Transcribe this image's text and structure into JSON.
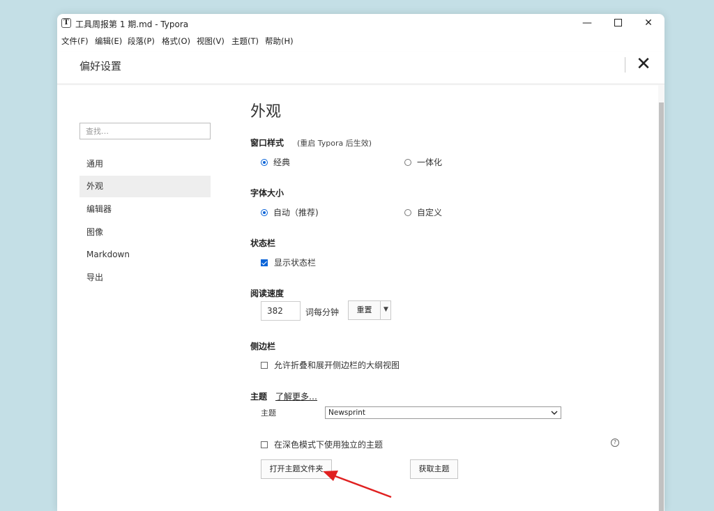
{
  "window": {
    "app_icon": "T",
    "title": "工具周报第 1 期.md - Typora",
    "controls": {
      "minimize": "—",
      "close": "✕"
    }
  },
  "menu": [
    "文件(F)",
    "编辑(E)",
    "段落(P)",
    "格式(O)",
    "视图(V)",
    "主题(T)",
    "帮助(H)"
  ],
  "preferences": {
    "title": "偏好设置",
    "close": "✕",
    "search": {
      "placeholder": "查找…",
      "value": ""
    },
    "nav": [
      "通用",
      "外观",
      "编辑器",
      "图像",
      "Markdown",
      "导出"
    ],
    "active_nav": "外观"
  },
  "appearance": {
    "heading": "外观",
    "window_style": {
      "label": "窗口样式",
      "note": "(重启 Typora 后生效)",
      "options": [
        "经典",
        "一体化"
      ],
      "selected": "经典"
    },
    "font_size": {
      "label": "字体大小",
      "options": [
        "自动（推荐)",
        "自定义"
      ],
      "selected": "自动（推荐)"
    },
    "status_bar": {
      "label": "状态栏",
      "checkbox_label": "显示状态栏",
      "checked": true
    },
    "reading_speed": {
      "label": "阅读速度",
      "value": "382",
      "unit": "词每分钟",
      "reset_button": "重置",
      "dropdown_glyph": "▼"
    },
    "sidebar": {
      "label": "侧边栏",
      "checkbox_label": "允许折叠和展开侧边栏的大纲视图",
      "checked": false
    },
    "theme": {
      "label": "主题",
      "learn_more": "了解更多…",
      "select_label": "主题",
      "selected_theme": "Newsprint",
      "dark_mode_label": "在深色模式下使用独立的主题",
      "dark_mode_checked": false,
      "help_glyph": "?",
      "open_folder_button": "打开主题文件夹",
      "get_themes_button": "获取主题"
    }
  },
  "colors": {
    "desktop": "#c4dfe6",
    "accent": "#0a64d8",
    "annotation_arrow": "#e02020"
  }
}
